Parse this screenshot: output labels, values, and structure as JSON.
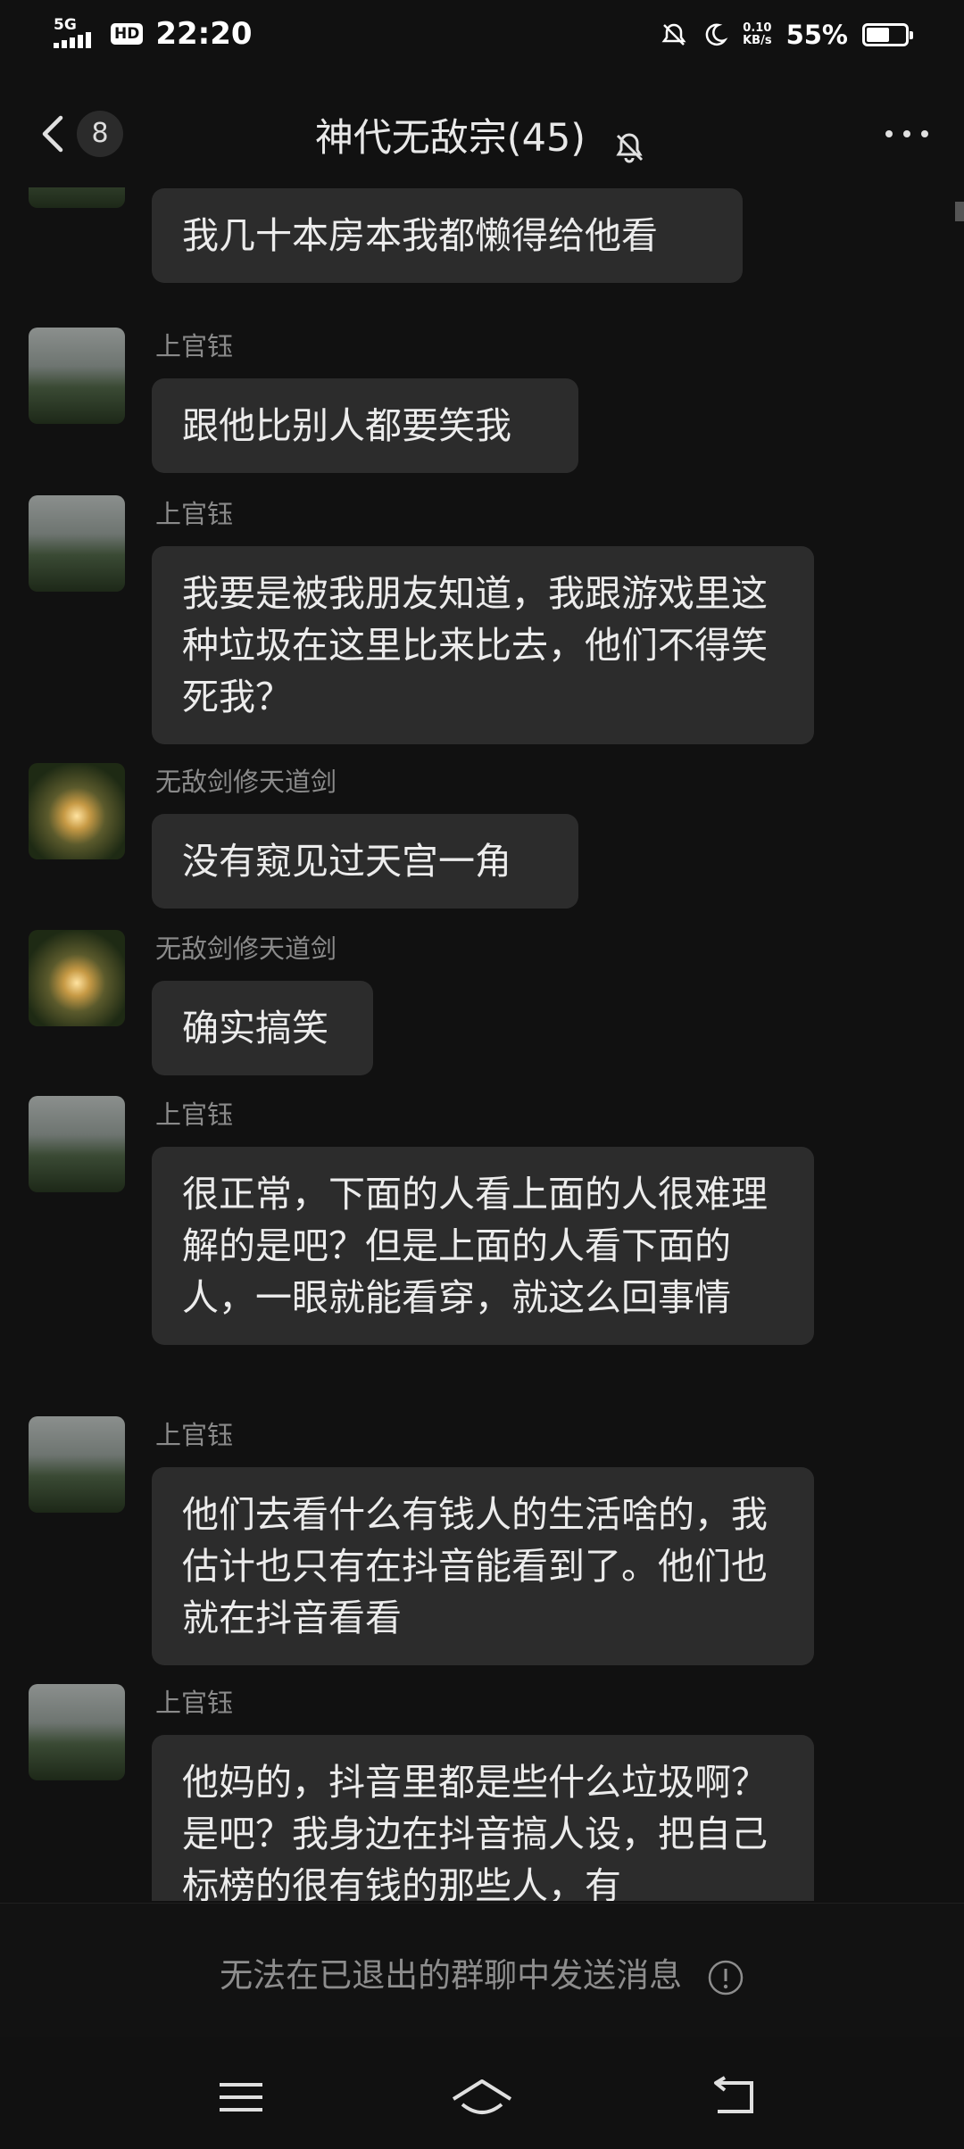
{
  "status_bar": {
    "network": "5G",
    "hd": "HD",
    "time": "22:20",
    "speed_value": "0.10",
    "speed_unit": "KB/s",
    "battery_percent": "55%",
    "battery_level": 0.55
  },
  "header": {
    "unread_count": "8",
    "title": "神代无敌宗(45)"
  },
  "messages": [
    {
      "sender": "上官钰",
      "text": "我几十本房本我都懒得给他看"
    },
    {
      "sender": "上官钰",
      "text": "跟他比别人都要笑我"
    },
    {
      "sender": "上官钰",
      "text": "我要是被我朋友知道，我跟游戏里这种垃圾在这里比来比去，他们不得笑死我？"
    },
    {
      "sender": "无敌剑修天道剑",
      "text": "没有窥见过天宫一角"
    },
    {
      "sender": "无敌剑修天道剑",
      "text": "确实搞笑"
    },
    {
      "sender": "上官钰",
      "text": "很正常，下面的人看上面的人很难理解的是吧？但是上面的人看下面的人，一眼就能看穿，就这么回事情"
    },
    {
      "sender": "上官钰",
      "text": "他们去看什么有钱人的生活啥的，我估计也只有在抖音能看到了。他们也就在抖音看看"
    },
    {
      "sender": "上官钰",
      "text": "他妈的，抖音里都是些什么垃圾啊？是吧？我身边在抖音搞人设，把自己标榜的很有钱的那些人，有"
    }
  ],
  "footer": {
    "blocked_notice": "无法在已退出的群聊中发送消息"
  },
  "icons": {
    "back": "chevron-left-icon",
    "mute": "bell-off-icon",
    "more": "more-dots-icon",
    "info": "info-icon",
    "nav_menu": "menu-icon",
    "nav_home": "home-icon",
    "nav_back": "back-icon"
  }
}
